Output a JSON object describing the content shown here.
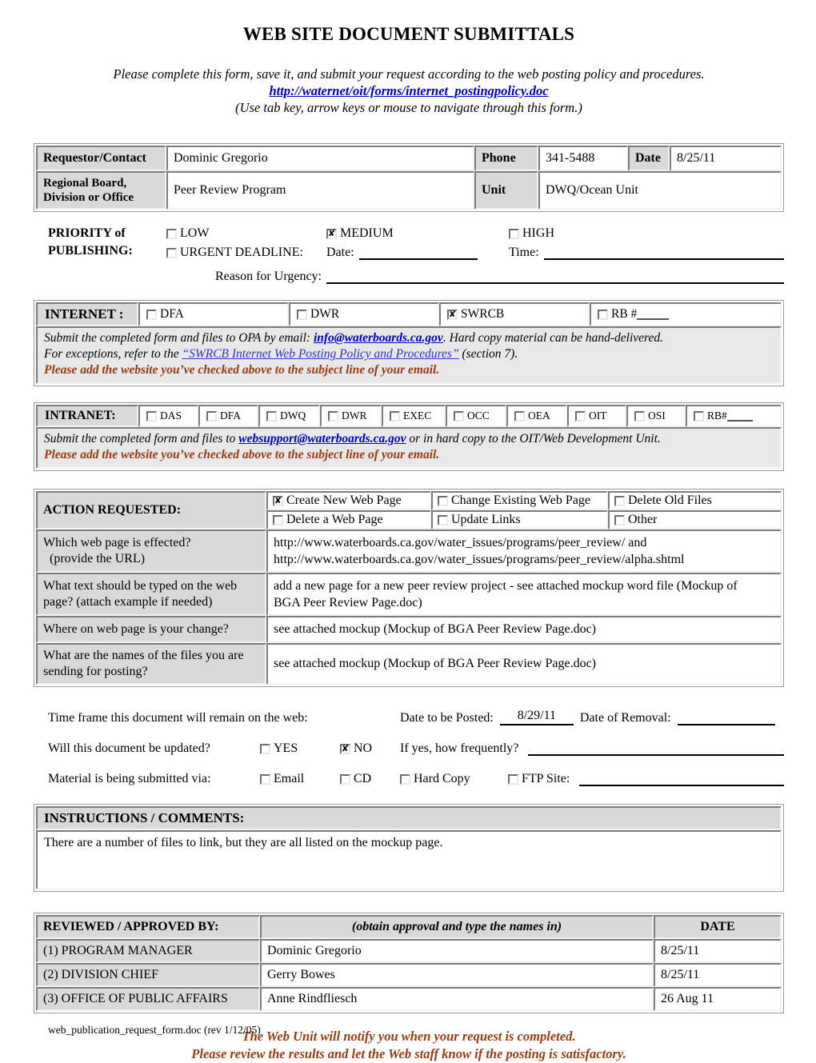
{
  "header": {
    "title": "WEB SITE DOCUMENT SUBMITTALS",
    "intro_line1": "Please complete this form, save it, and submit your request according to the web posting policy and procedures.",
    "policy_link": "http://waternet/oit/forms/internet_postingpolicy.doc",
    "intro_line3": "(Use tab key, arrow keys or mouse to navigate through this form.)"
  },
  "requestor": {
    "contact_label": "Requestor/Contact",
    "contact_value": "Dominic Gregorio",
    "phone_label": "Phone",
    "phone_value": "341-5488",
    "date_label": "Date",
    "date_value": "8/25/11",
    "office_label": "Regional Board, Division or Office",
    "office_label_line1": "Regional Board,",
    "office_label_line2": "Division or Office",
    "office_value": "Peer Review Program",
    "unit_label": "Unit",
    "unit_value": "DWQ/Ocean Unit"
  },
  "priority": {
    "label_line1": "PRIORITY of",
    "label_line2": "PUBLISHING:",
    "low": "LOW",
    "low_checked": false,
    "medium": "MEDIUM",
    "medium_checked": true,
    "high": "HIGH",
    "high_checked": false,
    "urgent": "URGENT DEADLINE:",
    "urgent_checked": false,
    "date_label": "Date:",
    "date_value": "",
    "time_label": "Time:",
    "time_value": "",
    "reason_label": "Reason for Urgency:",
    "reason_value": ""
  },
  "internet": {
    "tag": "INTERNET :",
    "options": [
      {
        "label": "DFA",
        "checked": false
      },
      {
        "label": "DWR",
        "checked": false
      },
      {
        "label": "SWRCB",
        "checked": true
      },
      {
        "label": "RB #",
        "checked": false,
        "has_blank": true
      }
    ],
    "note_line1_pre": "Submit the completed form and files to OPA by email: ",
    "note_line1_link": "info@waterboards.ca.gov",
    "note_line1_post": ". Hard copy material can be hand-delivered.",
    "note_line2_pre": "For exceptions, refer to the ",
    "note_line2_link": "“SWRCB Internet Web Posting Policy and Procedures”",
    "note_line2_post": " (section 7).",
    "note_warn": "Please add the website you’ve checked above to the subject line of your email."
  },
  "intranet": {
    "tag": "INTRANET:",
    "options": [
      {
        "label": "DAS",
        "checked": false
      },
      {
        "label": "DFA",
        "checked": false
      },
      {
        "label": "DWQ",
        "checked": false
      },
      {
        "label": "DWR",
        "checked": false
      },
      {
        "label": "EXEC",
        "checked": false
      },
      {
        "label": "OCC",
        "checked": false
      },
      {
        "label": "OEA",
        "checked": false
      },
      {
        "label": "OIT",
        "checked": false
      },
      {
        "label": "OSI",
        "checked": false
      },
      {
        "label": "RB#",
        "checked": false,
        "has_blank": true
      }
    ],
    "note_line1_pre": "Submit the completed form and files to ",
    "note_line1_link": "websupport@waterboards.ca.gov",
    "note_line1_post": " or in hard copy to the OIT/Web Development Unit.",
    "note_warn": "Please add the website you’ve checked above to the subject line of your email."
  },
  "action": {
    "label": "ACTION REQUESTED:",
    "options_row1": [
      {
        "label": "Create New Web Page",
        "checked": true
      },
      {
        "label": "Change Existing Web Page",
        "checked": false
      },
      {
        "label": "Delete Old Files",
        "checked": false
      }
    ],
    "options_row2": [
      {
        "label": "Delete a Web Page",
        "checked": false
      },
      {
        "label": "Update Links",
        "checked": false
      },
      {
        "label": "Other",
        "checked": false
      }
    ],
    "rows": [
      {
        "question_line1": "Which web page is effected?",
        "question_line2": "(provide the URL)",
        "answer_line1": "http://www.waterboards.ca.gov/water_issues/programs/peer_review/ and",
        "answer_line2": "http://www.waterboards.ca.gov/water_issues/programs/peer_review/alpha.shtml"
      },
      {
        "question_line1": "What text should be typed on the web",
        "question_line2": "page? (attach example if needed)",
        "answer_line1": "add a new page for a new peer review project - see attached mockup word file (Mockup of",
        "answer_line2": "BGA Peer Review Page.doc)"
      },
      {
        "question_line1": "Where on web page is your change?",
        "question_line2": "",
        "answer_line1": "see attached mockup (Mockup of BGA Peer Review Page.doc)",
        "answer_line2": ""
      },
      {
        "question_line1": "What are the names of the files you are",
        "question_line2": "sending for posting?",
        "answer_line1": "see attached mockup (Mockup of BGA Peer Review Page.doc)",
        "answer_line2": ""
      }
    ]
  },
  "timeframe": {
    "line1_label": "Time frame this document will remain on the web:",
    "posted_label": "Date to be Posted:",
    "posted_value": "8/29/11",
    "removal_label": "Date of Removal:",
    "removal_value": "",
    "updated_label": "Will this document be updated?",
    "yes_label": "YES",
    "yes_checked": false,
    "no_label": "NO",
    "no_checked": true,
    "frequency_label": "If yes, how frequently?",
    "frequency_value": "",
    "submitted_label": "Material is being submitted via:",
    "email_label": "Email",
    "email_checked": false,
    "cd_label": "CD",
    "cd_checked": false,
    "hardcopy_label": "Hard Copy",
    "hardcopy_checked": false,
    "ftp_label": "FTP Site:",
    "ftp_checked": false,
    "ftp_value": ""
  },
  "instructions": {
    "header": "INSTRUCTIONS / COMMENTS:",
    "body": "There are a number of files to link, but they are all listed on the mockup page."
  },
  "approvals": {
    "col1_header": "REVIEWED / APPROVED BY:",
    "col2_header": "(obtain approval and  type the names in)",
    "col3_header": "DATE",
    "rows": [
      {
        "role": "(1) PROGRAM MANAGER",
        "name": "Dominic Gregorio",
        "date": "8/25/11"
      },
      {
        "role": "(2) DIVISION CHIEF",
        "name": "Gerry Bowes",
        "date": "8/25/11"
      },
      {
        "role": "(3) OFFICE OF PUBLIC AFFAIRS",
        "name": "Anne Rindfliesch",
        "date": "26 Aug 11"
      }
    ]
  },
  "closing": {
    "line1": "The Web Unit will notify you when your request is completed.",
    "line2": "Please review the results and let the Web staff know if the posting is satisfactory."
  },
  "footer": {
    "text": "web_publication_request_form.doc (rev 1/12/05)"
  },
  "colors": {
    "link": "#0000cc",
    "warning": "#9c3a12",
    "shade": "#d9d9d9",
    "note_bg": "#e8e8e8"
  }
}
